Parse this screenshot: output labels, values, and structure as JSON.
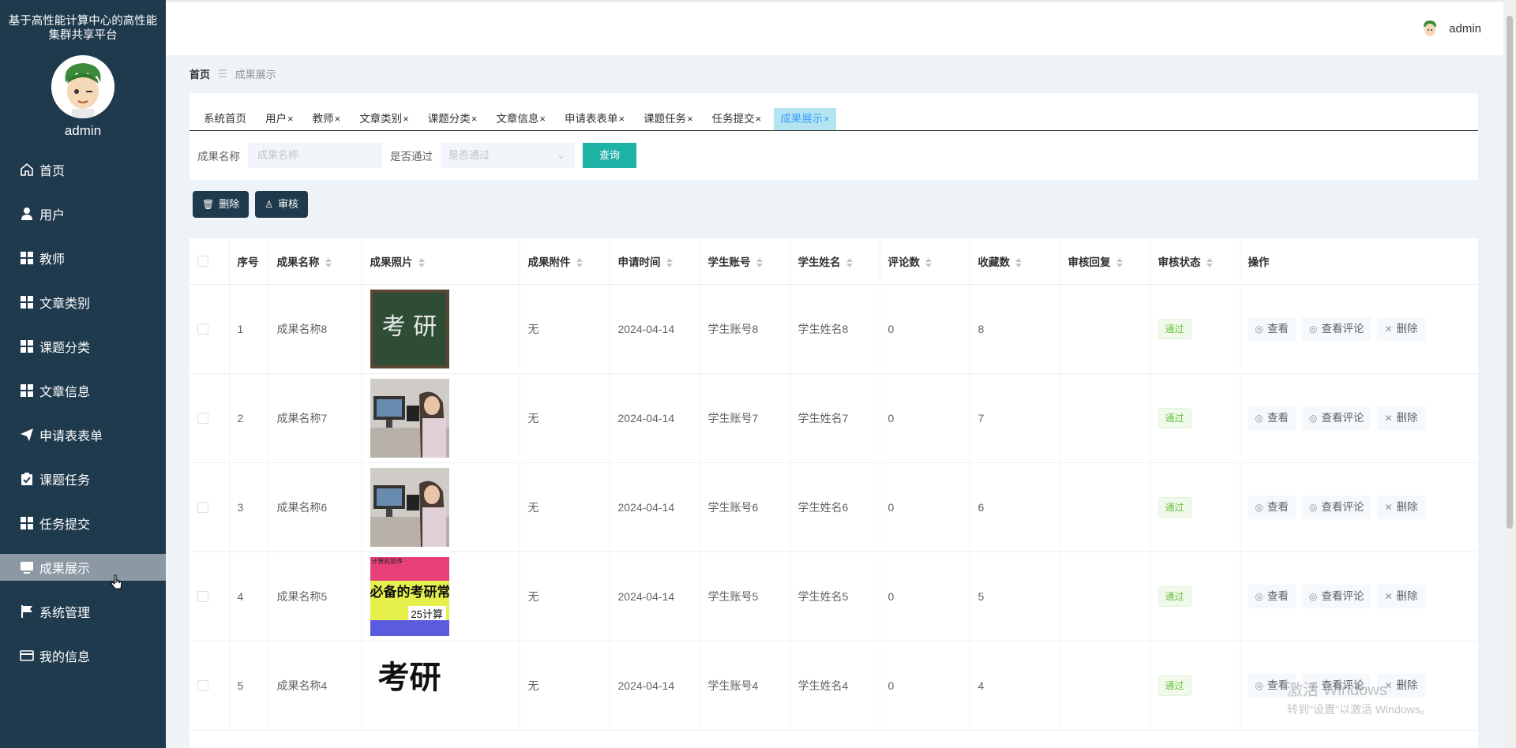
{
  "sidebar": {
    "title": "基于高性能计算中心的高性能集群共享平台",
    "username": "admin",
    "items": [
      {
        "label": "首页",
        "icon": "home-icon"
      },
      {
        "label": "用户",
        "icon": "user-icon"
      },
      {
        "label": "教师",
        "icon": "grid-icon"
      },
      {
        "label": "文章类别",
        "icon": "grid-icon"
      },
      {
        "label": "课题分类",
        "icon": "grid-icon"
      },
      {
        "label": "文章信息",
        "icon": "grid-icon"
      },
      {
        "label": "申请表表单",
        "icon": "send-icon"
      },
      {
        "label": "课题任务",
        "icon": "clipboard-check-icon"
      },
      {
        "label": "任务提交",
        "icon": "grid-icon"
      },
      {
        "label": "成果展示",
        "icon": "monitor-icon"
      },
      {
        "label": "系统管理",
        "icon": "flag-icon"
      },
      {
        "label": "我的信息",
        "icon": "id-card-icon"
      }
    ],
    "active_index": 9
  },
  "header": {
    "username": "admin"
  },
  "breadcrumb": {
    "home": "首页",
    "current": "成果展示"
  },
  "tabs": [
    {
      "label": "系统首页",
      "closable": false
    },
    {
      "label": "用户",
      "closable": true
    },
    {
      "label": "教师",
      "closable": true
    },
    {
      "label": "文章类别",
      "closable": true
    },
    {
      "label": "课题分类",
      "closable": true
    },
    {
      "label": "文章信息",
      "closable": true
    },
    {
      "label": "申请表表单",
      "closable": true
    },
    {
      "label": "课题任务",
      "closable": true
    },
    {
      "label": "任务提交",
      "closable": true
    },
    {
      "label": "成果展示",
      "closable": true
    }
  ],
  "active_tab": 9,
  "search": {
    "name_label": "成果名称",
    "name_placeholder": "成果名称",
    "pass_label": "是否通过",
    "pass_placeholder": "是否通过",
    "query_button": "查询"
  },
  "actions": {
    "delete": "删除",
    "review": "审核"
  },
  "table": {
    "headers": [
      "序号",
      "成果名称",
      "成果照片",
      "成果附件",
      "申请时间",
      "学生账号",
      "学生姓名",
      "评论数",
      "收藏数",
      "审核回复",
      "审核状态",
      "操作"
    ],
    "op_labels": {
      "view": "查看",
      "view_comments": "查看评论",
      "delete": "删除"
    },
    "rows": [
      {
        "index": "1",
        "name": "成果名称8",
        "photo": "blackboard",
        "attachment": "无",
        "date": "2024-04-14",
        "account": "学生账号8",
        "student": "学生姓名8",
        "comments": "0",
        "favorites": "8",
        "reply": "",
        "status": "通过"
      },
      {
        "index": "2",
        "name": "成果名称7",
        "photo": "study-room",
        "attachment": "无",
        "date": "2024-04-14",
        "account": "学生账号7",
        "student": "学生姓名7",
        "comments": "0",
        "favorites": "7",
        "reply": "",
        "status": "通过"
      },
      {
        "index": "3",
        "name": "成果名称6",
        "photo": "study-room",
        "attachment": "无",
        "date": "2024-04-14",
        "account": "学生账号6",
        "student": "学生姓名6",
        "comments": "0",
        "favorites": "6",
        "reply": "",
        "status": "通过"
      },
      {
        "index": "4",
        "name": "成果名称5",
        "photo": "poster",
        "attachment": "无",
        "date": "2024-04-14",
        "account": "学生账号5",
        "student": "学生姓名5",
        "comments": "0",
        "favorites": "5",
        "reply": "",
        "status": "通过"
      },
      {
        "index": "5",
        "name": "成果名称4",
        "photo": "kaoyan-text",
        "attachment": "无",
        "date": "2024-04-14",
        "account": "学生账号4",
        "student": "学生姓名4",
        "comments": "0",
        "favorites": "4",
        "reply": "",
        "status": "通过"
      }
    ]
  },
  "photo_text": {
    "blackboard": "考 研",
    "poster_top": "必备的考研常",
    "poster_bottom": "25计算",
    "poster_tag": "计算机软件",
    "kaoyan": "考研"
  },
  "watermark": {
    "line1": "激活 Windows",
    "line2": "转到\"设置\"以激活 Windows。"
  },
  "colors": {
    "sidebar_bg": "#1f3a4d",
    "active_menu": "#8c99a5",
    "accent": "#1fb2a6",
    "status_green": "#67c23a"
  }
}
